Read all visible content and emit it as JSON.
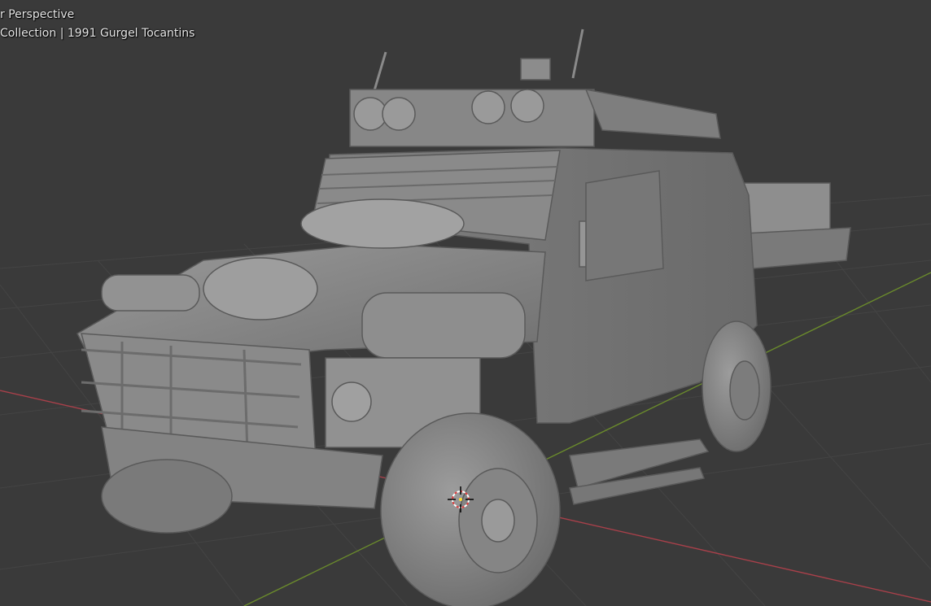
{
  "viewport": {
    "view_name": "r Perspective",
    "collection_info": "Collection | 1991 Gurgel Tocantins",
    "colors": {
      "background": "#3a3a3a",
      "grid": "#444444",
      "x_axis": "#a8404a",
      "y_axis": "#6a8a2c",
      "model": "#8e8e8e"
    },
    "icons": [
      "3d-cursor-icon"
    ]
  }
}
